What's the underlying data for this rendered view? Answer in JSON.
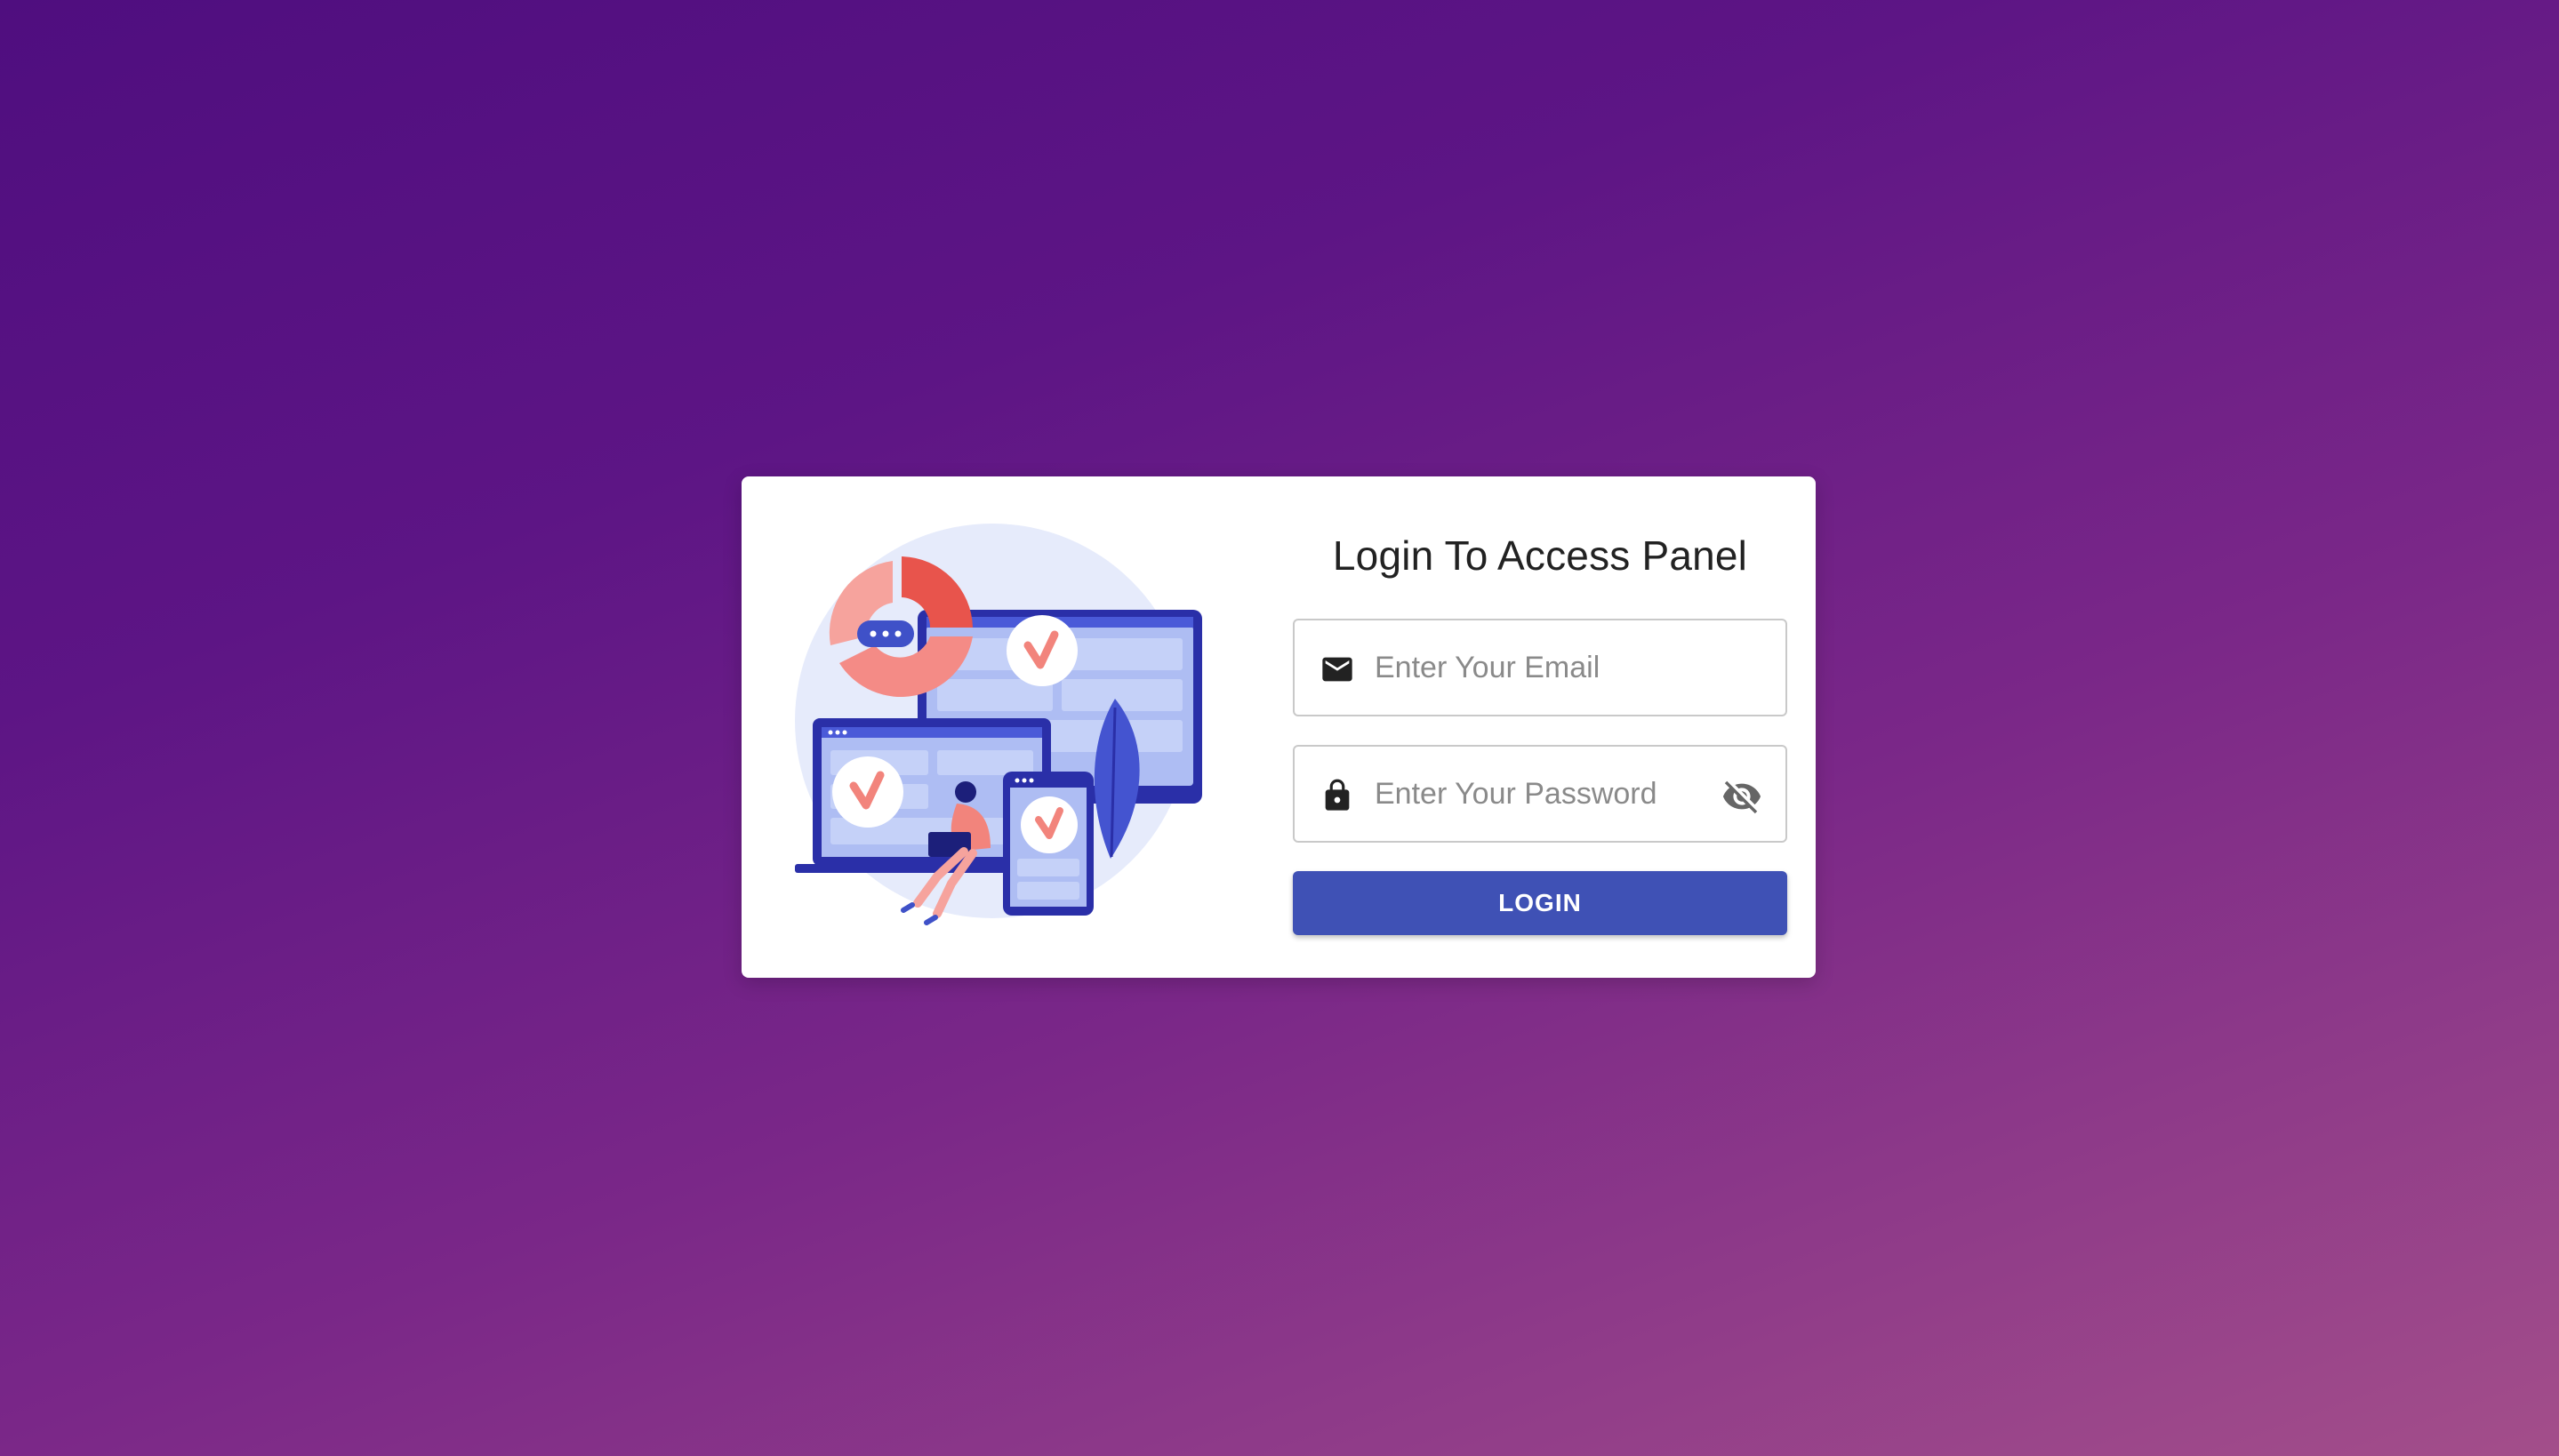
{
  "login": {
    "title": "Login To Access Panel",
    "email": {
      "placeholder": "Enter Your Email",
      "value": "",
      "icon": "mail-icon"
    },
    "password": {
      "placeholder": "Enter Your Password",
      "value": "",
      "icon": "lock-icon",
      "toggle_icon": "eye-off-icon"
    },
    "submit_label": "LOGIN"
  },
  "illustration": {
    "icon": "devices-checkmark-illustration"
  },
  "colors": {
    "background_start": "#4f0e7f",
    "background_end": "#a34e8a",
    "primary": "#3f51b5",
    "card": "#ffffff",
    "accent": "#f2847c"
  }
}
